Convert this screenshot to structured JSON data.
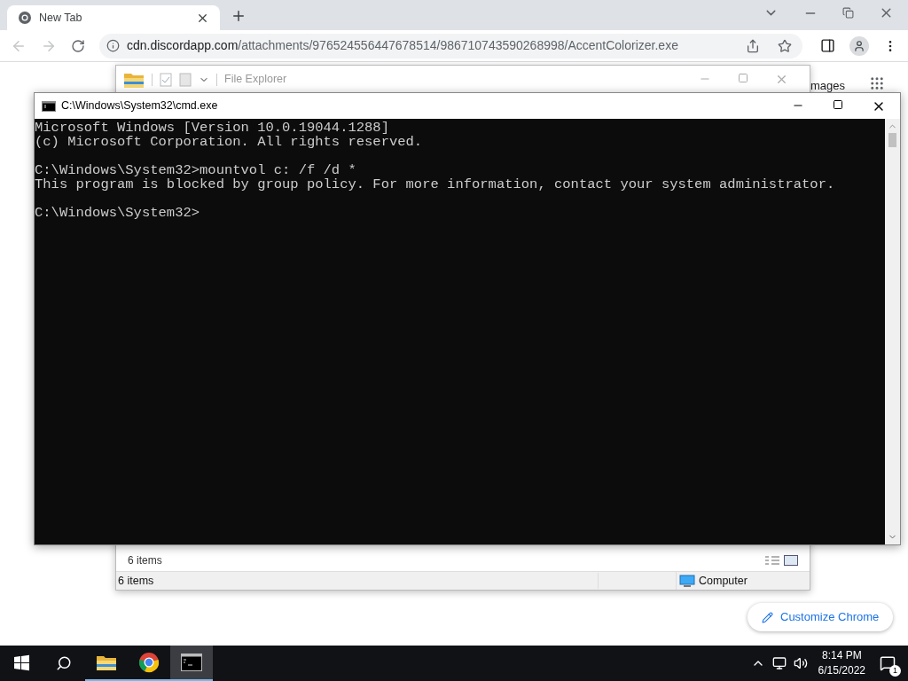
{
  "browser": {
    "tab": {
      "title": "New Tab",
      "selected": true
    },
    "url_host": "cdn.discordapp.com",
    "url_path": "/attachments/976524556447678514/986710743590268998/AccentColorizer.exe",
    "page_link": "mages",
    "customize_button": "Customize Chrome"
  },
  "explorer": {
    "title": "File Explorer",
    "items_count": "6 items",
    "status_count": "6 items",
    "location": "Computer"
  },
  "console": {
    "title": "C:\\Windows\\System32\\cmd.exe",
    "blocks": [
      {
        "lines": [
          "Microsoft Windows [Version 10.0.19044.1288]",
          "(c) Microsoft Corporation. All rights reserved."
        ]
      },
      {
        "lines": [
          "C:\\Windows\\System32>mountvol c: /f /d *",
          "This program is blocked by group policy. For more information, contact your system administrator."
        ]
      },
      {
        "lines": [
          "C:\\Windows\\System32>"
        ]
      }
    ]
  },
  "taskbar": {
    "apps": [
      {
        "kind": "explorer",
        "active": false
      },
      {
        "kind": "chrome",
        "active": false
      },
      {
        "kind": "cmd",
        "active": true
      }
    ],
    "time": "8:14 PM",
    "date": "6/15/2022",
    "notifications": "1"
  }
}
